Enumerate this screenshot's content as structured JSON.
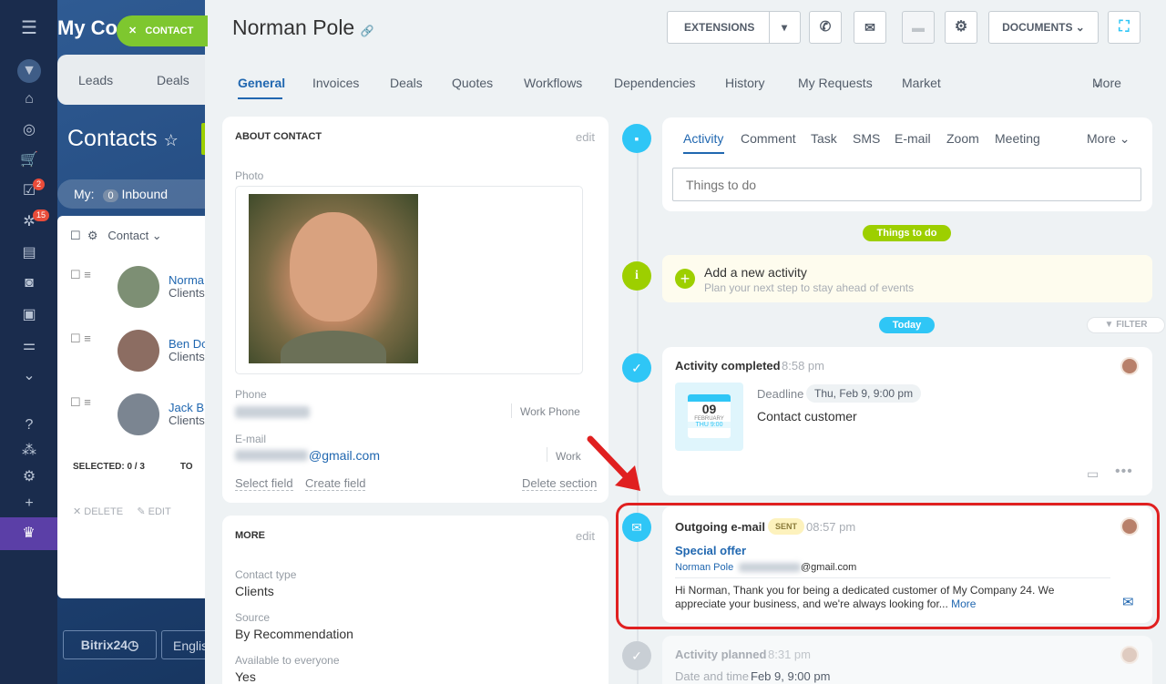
{
  "background": {
    "title": "My Co",
    "tabs": [
      "Leads",
      "Deals"
    ],
    "page_title": "Contacts",
    "filter": {
      "label": "My:",
      "count": "0",
      "name": "Inbound"
    },
    "grid_header": "Contact",
    "rows": [
      {
        "name": "Norma",
        "sub": "Clients"
      },
      {
        "name": "Ben Do",
        "sub": "Clients"
      },
      {
        "name": "Jack B",
        "sub": "Clients"
      }
    ],
    "selected": "SELECTED: 0 / 3",
    "selected_tail": "TO",
    "delete": "DELETE",
    "edit": "EDIT",
    "brand": "Bitrix24",
    "lang": "Englis",
    "badges": {
      "tasks": "2",
      "apps": "15"
    }
  },
  "close_button": "CONTACT",
  "header": {
    "name": "Norman Pole",
    "extensions": "EXTENSIONS",
    "documents": "DOCUMENTS"
  },
  "tabs": [
    "General",
    "Invoices",
    "Deals",
    "Quotes",
    "Workflows",
    "Dependencies",
    "History",
    "My Requests",
    "Market",
    "More"
  ],
  "about": {
    "title": "ABOUT CONTACT",
    "edit": "edit",
    "photo_label": "Photo",
    "phone_label": "Phone",
    "phone_type": "Work Phone",
    "email_label": "E-mail",
    "email_domain": "@gmail.com",
    "email_type": "Work",
    "select_field": "Select field",
    "create_field": "Create field",
    "delete_section": "Delete section"
  },
  "more": {
    "title": "MORE",
    "edit": "edit",
    "contact_type_label": "Contact type",
    "contact_type": "Clients",
    "source_label": "Source",
    "source": "By Recommendation",
    "available_label": "Available to everyone",
    "available": "Yes"
  },
  "activity_tabs": [
    "Activity",
    "Comment",
    "Task",
    "SMS",
    "E-mail",
    "Zoom",
    "Meeting",
    "More"
  ],
  "things_placeholder": "Things to do",
  "things_pill": "Things to do",
  "add_activity": {
    "title": "Add a new activity",
    "hint": "Plan your next step to stay ahead of events"
  },
  "today_pill": "Today",
  "filter_button": "FILTER",
  "completed": {
    "title": "Activity completed",
    "time": "8:58 pm",
    "deadline_label": "Deadline",
    "deadline": "Thu, Feb 9, 9:00 pm",
    "subject": "Contact customer",
    "cal_day": "09",
    "cal_month": "FEBRUARY",
    "cal_time": "THU 9:00"
  },
  "email": {
    "title": "Outgoing e-mail",
    "status": "SENT",
    "time": "08:57 pm",
    "subject": "Special offer",
    "to_name": "Norman Pole",
    "to_domain": "@gmail.com",
    "body": "Hi Norman, Thank you for being a dedicated customer of My Company 24. We appreciate your business, and we're always looking for...",
    "more": "More"
  },
  "planned": {
    "title": "Activity planned",
    "time": "8:31 pm",
    "date_label": "Date and time",
    "date": "Feb 9, 9:00 pm"
  },
  "colors": {
    "accent_green": "#9dcf00",
    "accent_blue": "#2fc6f6",
    "highlight": "#e02020",
    "link": "#2067b0"
  }
}
